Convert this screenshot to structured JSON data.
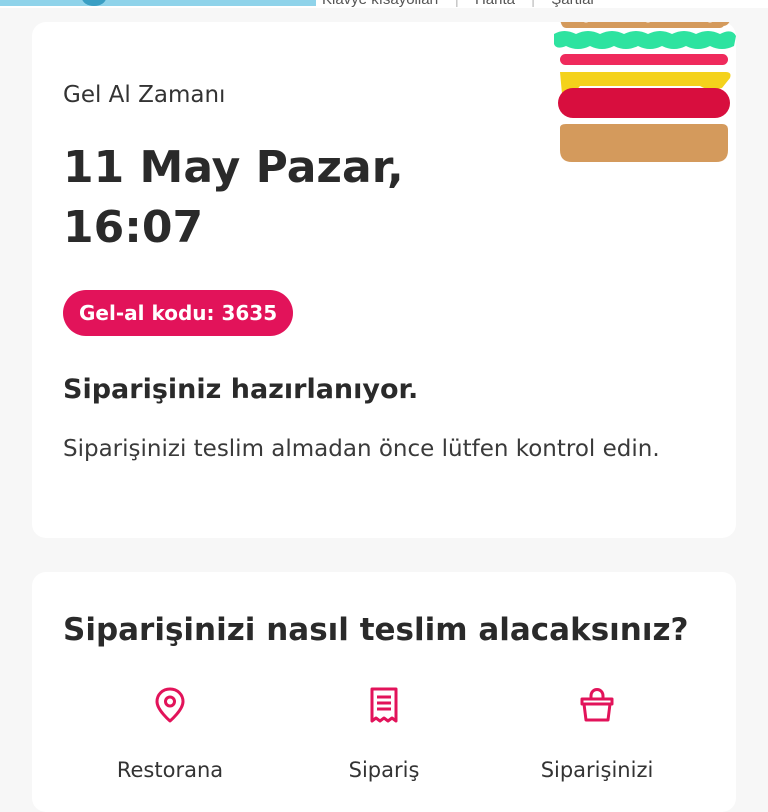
{
  "top_strip": {
    "links": [
      "Klavye kısayolları",
      "Harita",
      "Şartlar"
    ]
  },
  "pickup": {
    "label": "Gel Al Zamanı",
    "time": "11 May Pazar, 16:07",
    "code": "Gel-al kodu: 3635"
  },
  "status": {
    "title": "Siparişiniz hazırlanıyor.",
    "description": "Siparişinizi teslim almadan önce lütfen kontrol edin."
  },
  "collect": {
    "title": "Siparişinizi nasıl teslim alacaksınız?",
    "options": [
      {
        "label": "Restorana",
        "icon": "location-pin-icon"
      },
      {
        "label": "Sipariş",
        "icon": "receipt-icon"
      },
      {
        "label": "Siparişinizi",
        "icon": "shopping-bag-icon"
      }
    ]
  },
  "colors": {
    "accent": "#e2135a",
    "background": "#f7f7f7",
    "card": "#ffffff"
  }
}
